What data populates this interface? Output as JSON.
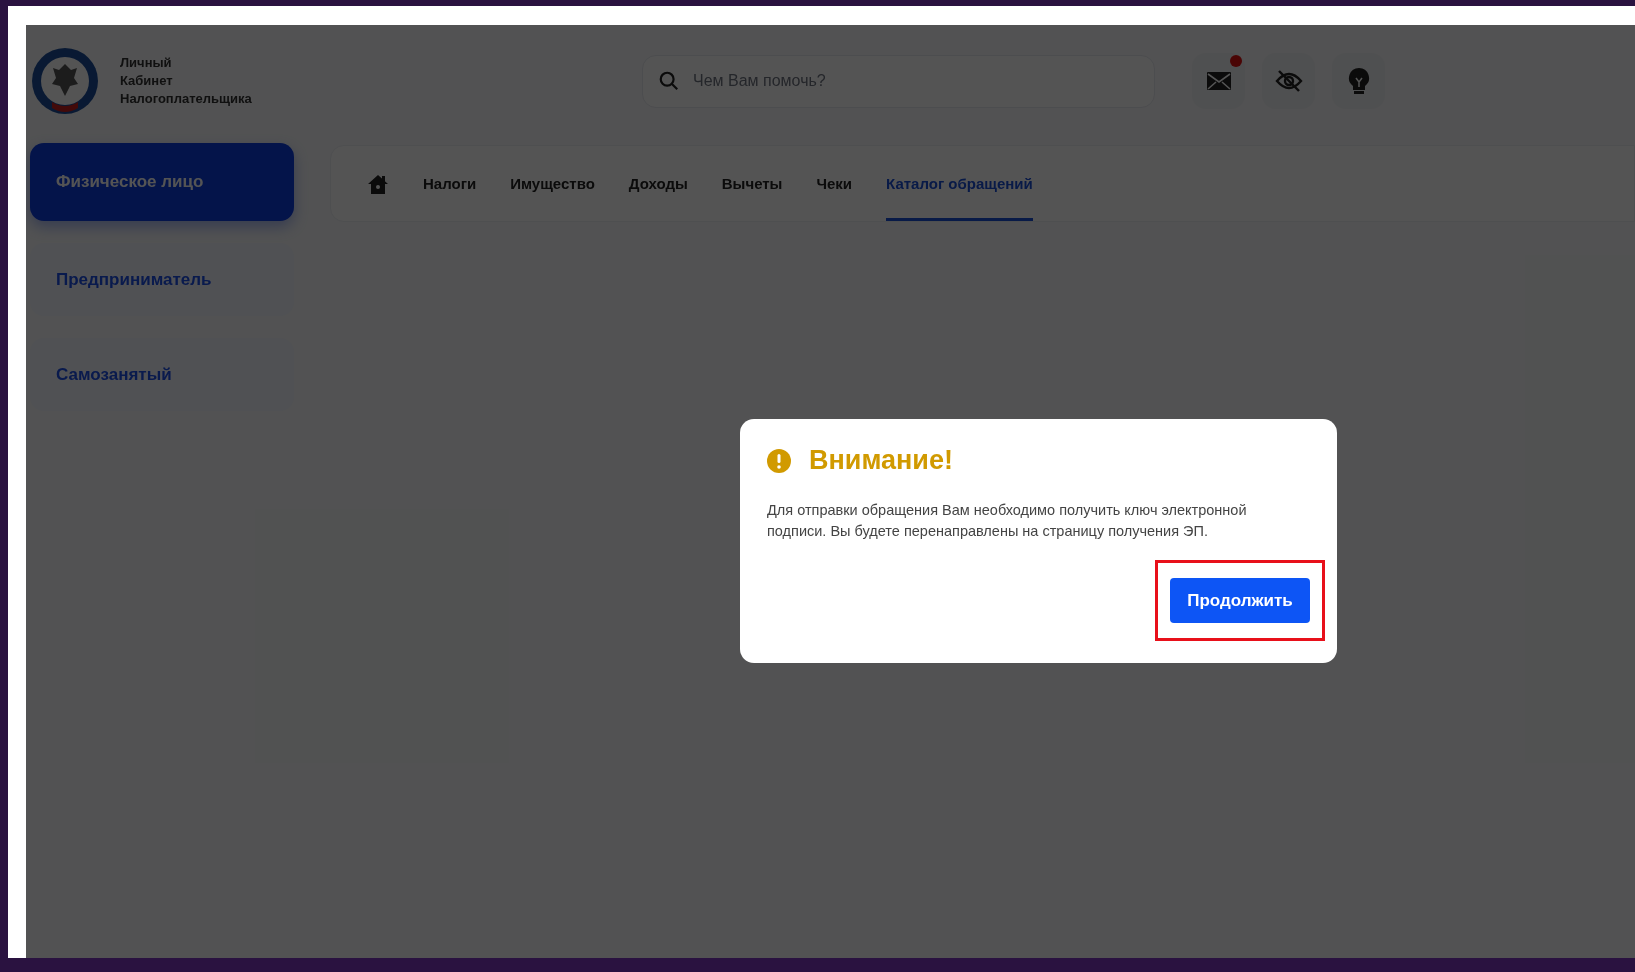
{
  "logo": {
    "lines": [
      "Личный",
      "Кабинет",
      "Налогоплательщика"
    ]
  },
  "search": {
    "placeholder": "Чем Вам помочь?"
  },
  "notifications": {
    "unread": true
  },
  "sidebar": {
    "items": [
      {
        "label": "Физическое лицо",
        "selected": true
      },
      {
        "label": "Предприниматель",
        "selected": false
      },
      {
        "label": "Самозанятый",
        "selected": false
      }
    ]
  },
  "tabs": [
    {
      "label": "Налоги",
      "selected": false
    },
    {
      "label": "Имущество",
      "selected": false
    },
    {
      "label": "Доходы",
      "selected": false
    },
    {
      "label": "Вычеты",
      "selected": false
    },
    {
      "label": "Чеки",
      "selected": false
    },
    {
      "label": "Каталог обращений",
      "selected": true
    }
  ],
  "dialog": {
    "title": "Внимание!",
    "message": "Для отправки обращения Вам необходимо получить ключ электронной подписи. Вы будете перенаправлены на страницу получения ЭП.",
    "button": {
      "label": "Продолжить",
      "highlighted": true
    }
  }
}
